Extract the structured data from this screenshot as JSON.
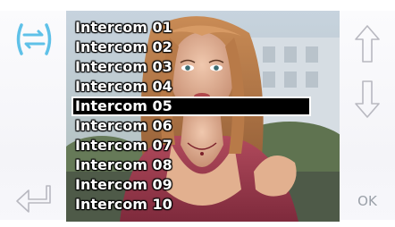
{
  "intercom_list": {
    "items": [
      {
        "label": "Intercom 01"
      },
      {
        "label": "Intercom 02"
      },
      {
        "label": "Intercom 03"
      },
      {
        "label": "Intercom 04"
      },
      {
        "label": "Intercom 05"
      },
      {
        "label": "Intercom 06"
      },
      {
        "label": "Intercom 07"
      },
      {
        "label": "Intercom 08"
      },
      {
        "label": "Intercom 09"
      },
      {
        "label": "Intercom 10"
      }
    ],
    "selected": "Intercom 05"
  },
  "left_panel": {
    "top_icon": "switch-arrows-icon",
    "bottom_icon": "back-enter-arrow-icon"
  },
  "right_panel": {
    "up_icon": "arrow-up-icon",
    "down_icon": "arrow-down-icon",
    "ok_label": "OK"
  },
  "colors": {
    "accent": "#5fc1e8",
    "icon_gray": "#b8b8c0",
    "selection_bg": "#000000",
    "list_text": "#ffffff"
  }
}
